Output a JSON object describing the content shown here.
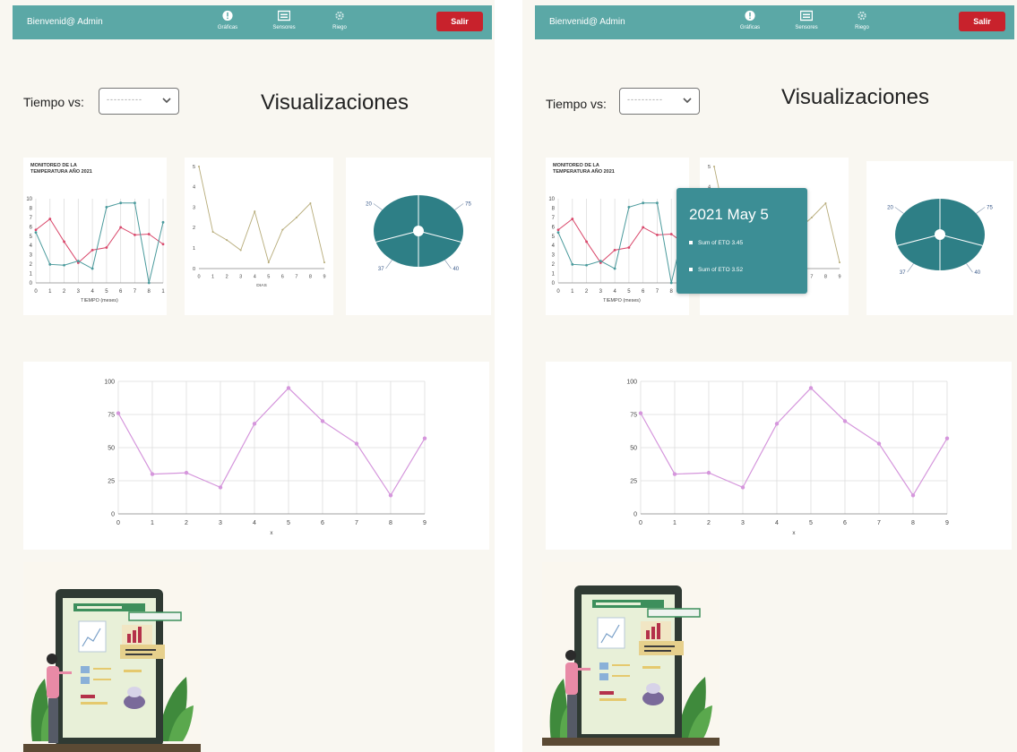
{
  "colors": {
    "navbar": "#5ba8a6",
    "logout": "#c8222c",
    "background": "#f9f7f1",
    "tooltip": "#3c8e95",
    "pie": "#2e7f86",
    "series_red": "#d9486b",
    "series_teal": "#4a9a9c",
    "series_olive": "#b7ac7a",
    "series_violet": "#d596dc"
  },
  "screens": [
    {
      "navbar": {
        "welcome": "Bienvenid@ Admin",
        "items": [
          {
            "label": "Gráficas",
            "icon": "info-circle-icon"
          },
          {
            "label": "Sensores",
            "icon": "keyboard-icon"
          },
          {
            "label": "Riego",
            "icon": "gear-icon"
          }
        ],
        "logout": "Salir"
      },
      "filter": {
        "label": "Tiempo vs:",
        "value": "----------"
      },
      "title": "Visualizaciones"
    },
    {
      "navbar": {
        "welcome": "Bienvenid@ Admin",
        "items": [
          {
            "label": "Gráficas",
            "icon": "info-circle-icon"
          },
          {
            "label": "Sensores",
            "icon": "keyboard-icon"
          },
          {
            "label": "Riego",
            "icon": "gear-icon"
          }
        ],
        "logout": "Salir"
      },
      "filter": {
        "label": "Tiempo vs:",
        "value": "----------"
      },
      "title": "Visualizaciones",
      "tooltip": {
        "title": "2021 May 5",
        "rows": [
          "Sum of ETO 3.45",
          "Sum of ETO 3.52"
        ]
      }
    }
  ],
  "chart_data": [
    {
      "type": "line",
      "title": "MONITOREO DE LA TEMPERATURA AÑO 2021",
      "xlabel": "TIEMPO (meses)",
      "ylabel": "",
      "x": [
        0,
        1,
        2,
        3,
        4,
        5,
        6,
        7,
        8,
        9
      ],
      "x_tick_labels": [
        "0",
        "1",
        "2",
        "3",
        "4",
        "5",
        "6",
        "7",
        "8",
        "1"
      ],
      "y_tick_labels": [
        "10",
        "8",
        "7",
        "6",
        "5",
        "4",
        "3",
        "2",
        "1",
        "0"
      ],
      "ylim": [
        0,
        10
      ],
      "series": [
        {
          "color": "#d9486b",
          "values": [
            6.3,
            7.6,
            4.9,
            2.4,
            3.9,
            4.2,
            6.6,
            5.7,
            5.8,
            4.6
          ]
        },
        {
          "color": "#4a9a9c",
          "values": [
            6.0,
            2.2,
            2.1,
            2.6,
            1.7,
            9.0,
            9.5,
            9.5,
            0.0,
            7.2
          ]
        }
      ]
    },
    {
      "type": "line",
      "title": "",
      "xlabel": "DIAS",
      "ylabel": "",
      "x": [
        0,
        1,
        2,
        3,
        4,
        5,
        6,
        7,
        8,
        9
      ],
      "x_tick_labels": [
        "0",
        "1",
        "2",
        "3",
        "4",
        "5",
        "6",
        "7",
        "8",
        "9"
      ],
      "y_tick_labels": [
        "5",
        "4",
        "3",
        "2",
        "1",
        "0"
      ],
      "ylim": [
        0,
        5
      ],
      "series": [
        {
          "color": "#b7ac7a",
          "values": [
            5.0,
            1.8,
            1.4,
            0.9,
            2.8,
            0.3,
            1.9,
            2.5,
            3.2,
            0.3
          ]
        }
      ]
    },
    {
      "type": "pie",
      "title": "",
      "labels": [
        "75",
        "40",
        "37",
        "20"
      ],
      "values": [
        30,
        20,
        20,
        30
      ],
      "style": "donut"
    },
    {
      "type": "line",
      "title": "",
      "xlabel": "x",
      "ylabel": "",
      "x": [
        0,
        1,
        2,
        3,
        4,
        5,
        6,
        7,
        8,
        9
      ],
      "y_tick_labels": [
        "100",
        "75",
        "50",
        "25",
        "0"
      ],
      "ylim": [
        0,
        100
      ],
      "grid": true,
      "series": [
        {
          "color": "#d596dc",
          "values": [
            76,
            30,
            31,
            20,
            68,
            95,
            70,
            53,
            14,
            57
          ]
        }
      ]
    }
  ]
}
